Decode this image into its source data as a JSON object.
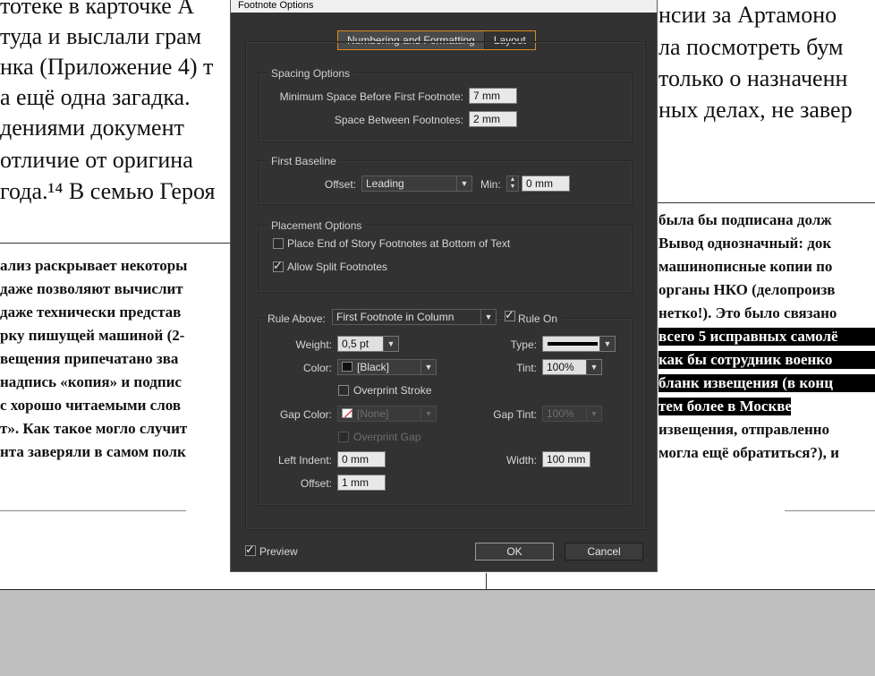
{
  "document": {
    "top_left": [
      "тотеке в карточке А",
      "туда и выслали грам",
      "нка (Приложение 4) т",
      "а ещё одна загадка.",
      "дениями документ",
      "отличие от оригина",
      "года.¹⁴ В семью Героя"
    ],
    "top_right": [
      "нсии за Артамоно",
      "ла посмотреть бум",
      "только о назначенн",
      "ных делах, не завер"
    ],
    "bottom_left": [
      "ализ раскрывает некоторы",
      "даже позволяют вычислит",
      "даже технически представ",
      "рку пишущей машиной (2-",
      "вещения припечатано зва",
      "надпись «копия» и подпис",
      "с хорошо читаемыми слов",
      "т». Как такое могло случит",
      "нта заверяли в самом полк"
    ],
    "bottom_right": [
      "была бы подписана долж",
      "Вывод однозначный: док",
      "машинописные копии по",
      "органы НКО (делопроизв",
      "нетко!). Это было связано",
      "всего 5 исправных самолё",
      "как бы сотрудник военко",
      "бланк извещения (в конц",
      "тем более в Москве). Жен",
      "извещения, отправленно",
      "могла ещё обратиться?), и"
    ]
  },
  "dialog": {
    "title": "Footnote Options",
    "tabs": [
      "Numbering and Formatting",
      "Layout"
    ],
    "spacing": {
      "title": "Spacing Options",
      "min_space_label": "Minimum Space Before First Footnote:",
      "min_space_value": "7 mm",
      "between_label": "Space Between Footnotes:",
      "between_value": "2 mm"
    },
    "baseline": {
      "title": "First Baseline",
      "offset_label": "Offset:",
      "offset_value": "Leading",
      "min_label": "Min:",
      "min_value": "0 mm"
    },
    "placement": {
      "title": "Placement Options",
      "end_of_story": "Place End of Story Footnotes at Bottom of Text",
      "split": "Allow Split Footnotes"
    },
    "rule": {
      "rule_above_label": "Rule Above:",
      "rule_above_value": "First Footnote in Column",
      "rule_on_label": "Rule On",
      "weight_label": "Weight:",
      "weight_value": "0,5 pt",
      "type_label": "Type:",
      "color_label": "Color:",
      "color_value": "[Black]",
      "tint_label": "Tint:",
      "tint_value": "100%",
      "overprint_stroke": "Overprint Stroke",
      "gap_color_label": "Gap Color:",
      "gap_color_value": "[None]",
      "gap_tint_label": "Gap Tint:",
      "gap_tint_value": "100%",
      "overprint_gap": "Overprint Gap",
      "left_indent_label": "Left Indent:",
      "left_indent_value": "0 mm",
      "width_label": "Width:",
      "width_value": "100 mm",
      "offset_label": "Offset:",
      "offset_value": "1 mm"
    },
    "preview_label": "Preview",
    "ok_label": "OK",
    "cancel_label": "Cancel"
  }
}
